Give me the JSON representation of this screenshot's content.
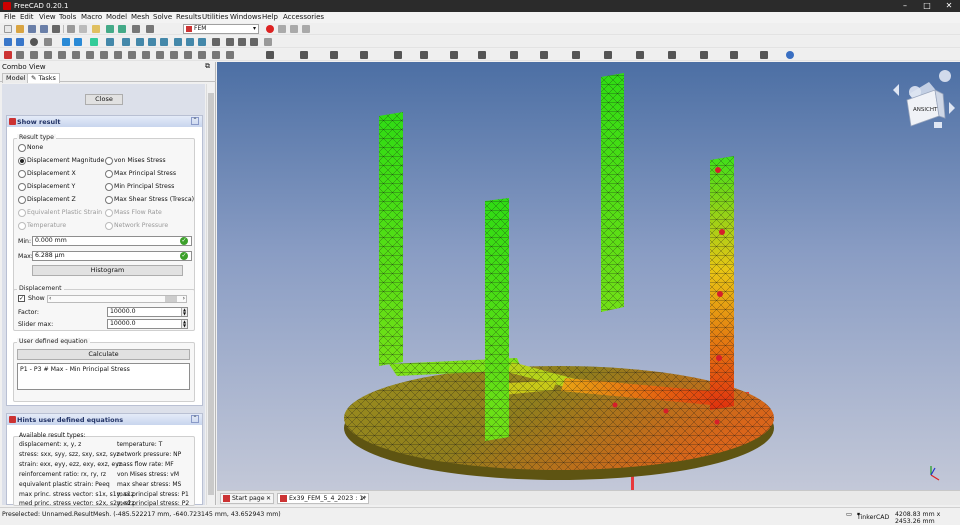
{
  "window": {
    "title": "FreeCAD 0.20.1"
  },
  "menu": [
    "File",
    "Edit",
    "View",
    "Tools",
    "Macro",
    "Model",
    "Mesh",
    "Solve",
    "Results",
    "Utilities",
    "Windows",
    "Help",
    "Accessories"
  ],
  "toolbar": {
    "workbench": "FEM"
  },
  "combo_view": {
    "title": "Combo View",
    "tabs": [
      "Model",
      "Tasks"
    ],
    "close_label": "Close"
  },
  "show_result": {
    "header": "Show result",
    "result_type_label": "Result type",
    "options_left": [
      "None",
      "Displacement Magnitude",
      "Displacement X",
      "Displacement Y",
      "Displacement Z",
      "Equivalent Plastic Strain",
      "Temperature"
    ],
    "options_right": [
      "von Mises Stress",
      "Max Principal Stress",
      "Min Principal Stress",
      "Max Shear Stress (Tresca)",
      "Mass Flow Rate",
      "Network Pressure"
    ],
    "selected": "Displacement Magnitude",
    "min_label": "Min:",
    "min_value": "0.000 mm",
    "max_label": "Max:",
    "max_value": "6.288 µm",
    "histogram_label": "Histogram",
    "displacement_label": "Displacement",
    "show_label": "Show",
    "factor_label": "Factor:",
    "factor_value": "10000.0",
    "slider_max_label": "Slider max:",
    "slider_max_value": "10000.0",
    "user_eq_label": "User defined equation",
    "calculate_label": "Calculate",
    "equation": "P1 - P3 # Max - Min Principal Stress"
  },
  "hints": {
    "header": "Hints user defined equations",
    "available_label": "Available result types:",
    "left": [
      "displacement: x, y, z",
      "stress: sxx, syy, szz, sxy, sxz, syz",
      "strain: exx, eyy, ezz, exy, exz, eyz",
      "reinforcement ratio: rx, ry, rz",
      "equivalent plastic strain: Peeq",
      "max princ. stress vector: s1x, s1y, s1z",
      "med princ. stress vector: s2x, s2y, s2z"
    ],
    "right": [
      "temperature: T",
      "network pressure: NP",
      "mass flow rate: MF",
      "von Mises stress: vM",
      "max shear stress: MS",
      "max principal stress: P1",
      "med principal stress: P2"
    ]
  },
  "doc_tabs": [
    "Start page",
    "Ex39_FEM_5_4_2023 : 1*"
  ],
  "status": {
    "preselected": "Preselected: Unnamed.ResultMesh. (-485.522217 mm, -640.723145 mm, 43.652943 mm)",
    "navigation": "TinkerCAD",
    "dimensions": "4208.83 mm x 2453.26 mm"
  },
  "navcube": {
    "face": "ANSICHT"
  },
  "colors": {
    "accent": "#c33333",
    "mesh_high": "#e83a10",
    "mesh_mid": "#e6cc17",
    "mesh_low": "#3fdc17"
  }
}
